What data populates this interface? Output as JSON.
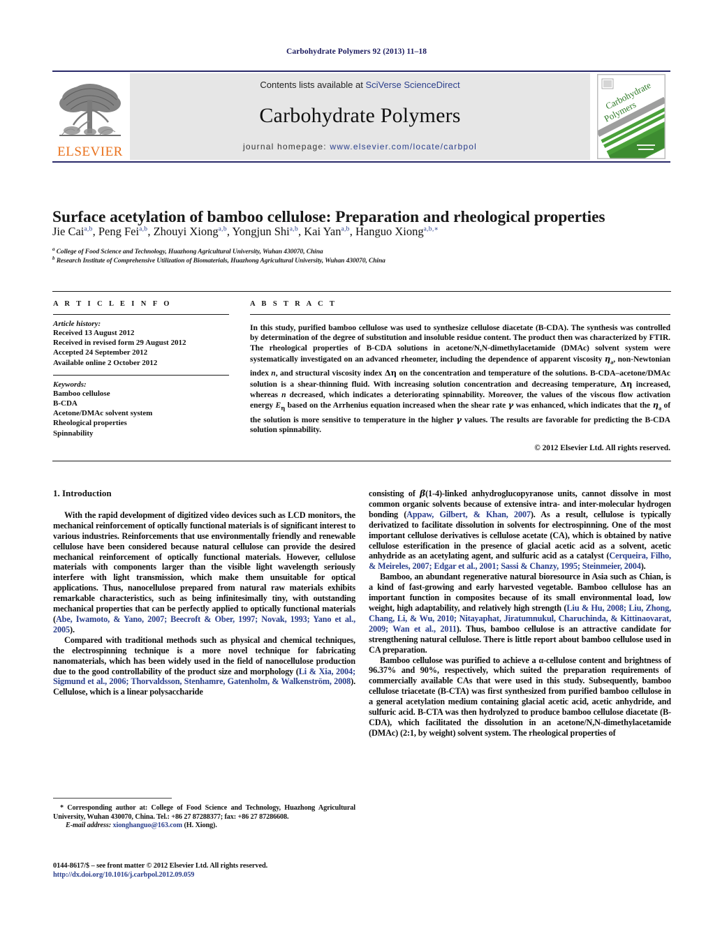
{
  "running_head": "Carbohydrate Polymers 92 (2013) 11–18",
  "masthead": {
    "publisher_logo_label": "ELSEVIER",
    "contents_prefix": "Contents lists available at ",
    "contents_link": "SciVerse ScienceDirect",
    "journal_title": "Carbohydrate Polymers",
    "homepage_prefix": "journal homepage: ",
    "homepage_url": "www.elsevier.com/locate/carbpol",
    "cover_title_line1": "Carbohydrate",
    "cover_title_line2": "Polymers",
    "link_color": "#2b3f8c",
    "logo_color": "#E9711C",
    "band_color": "#e6e6e6"
  },
  "article": {
    "title": "Surface acetylation of bamboo cellulose: Preparation and rheological properties",
    "authors": [
      {
        "name": "Jie Cai",
        "sup": "a,b"
      },
      {
        "name": "Peng Fei",
        "sup": "a,b"
      },
      {
        "name": "Zhouyi Xiong",
        "sup": "a,b"
      },
      {
        "name": "Yongjun Shi",
        "sup": "a,b"
      },
      {
        "name": "Kai Yan",
        "sup": "a,b"
      },
      {
        "name": "Hanguo Xiong",
        "sup": "a,b,∗"
      }
    ],
    "affiliations": [
      {
        "marker": "a",
        "text": "College of Food Science and Technology, Huazhong Agricultural University, Wuhan 430070, China"
      },
      {
        "marker": "b",
        "text": "Research Institute of Comprehensive Utilization of Biomaterials, Huazhong Agricultural University, Wuhan 430070, China"
      }
    ]
  },
  "article_info": {
    "heading": "A R T I C L E     I N F O",
    "history_label": "Article history:",
    "history": [
      "Received 13 August 2012",
      "Received in revised form 29 August 2012",
      "Accepted 24 September 2012",
      "Available online 2 October 2012"
    ],
    "keywords_label": "Keywords:",
    "keywords": [
      "Bamboo cellulose",
      "B-CDA",
      "Acetone/DMAc solvent system",
      "Rheological properties",
      "Spinnability"
    ]
  },
  "abstract": {
    "heading": "A B S T R A C T",
    "copyright": "© 2012 Elsevier Ltd. All rights reserved.",
    "p1_a": "In this study, purified bamboo cellulose was used to synthesize cellulose diacetate (B-CDA). The synthesis was controlled by determination of the degree of substitution and insoluble residue content. The product then was characterized by FTIR. The rheological properties of B-CDA solutions in acetone/N,N-dimethylacetamide (DMAc) solvent system were systematically investigated on an advanced rheometer, including the dependence of apparent viscosity ",
    "eta_a": "η",
    "eta_a_sub": "a",
    "p1_b": ", non-Newtonian index ",
    "n_sym": "n",
    "p1_c": ", and structural viscosity index ",
    "delta_eta": "Δη",
    "p1_d": " on the concentration and temperature of the solutions. B-CDA–acetone/DMAc solution is a shear-thinning fluid. With increasing solution concentration and decreasing temperature, ",
    "delta_eta2": "Δη",
    "p1_e": " increased, whereas ",
    "n_sym2": "n",
    "p1_f": " decreased, which indicates a deteriorating spinnability. Moreover, the values of the viscous flow activation energy ",
    "e_eta": "E",
    "e_eta_sub": "η",
    "p1_g": " based on the Arrhenius equation increased when the shear rate ",
    "gamma": "γ",
    "p1_h": " was enhanced, which indicates that the ",
    "eta_a2": "η",
    "eta_a2_sub": "a",
    "p1_i": " of the solution is more sensitive to temperature in the higher ",
    "gamma2": "γ",
    "p1_j": " values. The results are favorable for predicting the B-CDA solution spinnability."
  },
  "intro": {
    "heading": "1.  Introduction",
    "left": {
      "p1_a": "With the rapid development of digitized video devices such as LCD monitors, the mechanical reinforcement of optically functional materials is of significant interest to various industries. Reinforcements that use environmentally friendly and renewable cellulose have been considered because natural cellulose can provide the desired mechanical reinforcement of optically functional materials. However, cellulose materials with components larger than the visible light wavelength seriously interfere with light transmission, which make them unsuitable for optical applications. Thus, nanocellulose prepared from natural raw materials exhibits remarkable characteristics, such as being infinitesimally tiny, with outstanding mechanical properties that can be perfectly applied to optically functional materials (",
      "p1_cite": "Abe, Iwamoto, & Yano, 2007; Beecroft & Ober, 1997; Novak, 1993; Yano et al., 2005",
      "p1_b": ").",
      "p2_a": "Compared with traditional methods such as physical and chemical techniques, the electrospinning technique is a more novel technique for fabricating nanomaterials, which has been widely used in the field of nanocellulose production due to the good controllability of the product size and morphology (",
      "p2_cite": "Li & Xia, 2004; Sigmund et al., 2006; Thorvaldsson, Stenhamre, Gatenholm, & Walkenström, 2008",
      "p2_b": "). Cellulose, which is a linear polysaccharide"
    },
    "right": {
      "p1_a": "consisting of ",
      "p1_beta": "β",
      "p1_b": "(1-4)-linked anhydroglucopyranose units, cannot dissolve in most common organic solvents because of extensive intra- and inter-molecular hydrogen bonding (",
      "p1_cite": "Appaw, Gilbert, & Khan, 2007",
      "p1_c": "). As a result, cellulose is typically derivatized to facilitate dissolution in solvents for electrospinning. One of the most important cellulose derivatives is cellulose acetate (CA), which is obtained by native cellulose esterification in the presence of glacial acetic acid as a solvent, acetic anhydride as an acetylating agent, and sulfuric acid as a catalyst (",
      "p1_cite2": "Cerqueira, Filho, & Meireles, 2007; Edgar et al., 2001; Sassi & Chanzy, 1995; Steinmeier, 2004",
      "p1_d": ").",
      "p2_a": "Bamboo, an abundant regenerative natural bioresource in Asia such as Chian, is a kind of fast-growing and early harvested vegetable. Bamboo cellulose has an important function in composites because of its small environmental load, low weight, high adaptability, and relatively high strength (",
      "p2_cite": "Liu & Hu, 2008; Liu, Zhong, Chang, Li, & Wu, 2010; Nitayaphat, Jiratumnukul, Charuchinda, & Kittinaovarat, 2009; Wan et al., 2011",
      "p2_b": "). Thus, bamboo cellulose is an attractive candidate for strengthening natural cellulose. There is little report about bamboo cellulose used in CA preparation.",
      "p3": "Bamboo cellulose was purified to achieve a α-cellulose content and brightness of 96.37% and 90%, respectively, which suited the preparation requirements of commercially available CAs that were used in this study. Subsequently, bamboo cellulose triacetate (B-CTA) was first synthesized from purified bamboo cellulose in a general acetylation medium containing glacial acetic acid, acetic anhydride, and sulfuric acid. B-CTA was then hydrolyzed to produce bamboo cellulose diacetate (B-CDA), which facilitated the dissolution in an acetone/N,N-dimethylacetamide (DMAc) (2:1, by weight) solvent system. The rheological properties of"
    }
  },
  "footnotes": {
    "corresponding": "* Corresponding author at: College of Food Science and Technology, Huazhong Agricultural University, Wuhan 430070, China. Tel.: +86 27 87288377; fax: +86 27 87286608.",
    "email_label": "E-mail address:",
    "email": "xionghanguo@163.com",
    "email_suffix": " (H. Xiong)."
  },
  "imprint": {
    "line1": "0144-8617/$ – see front matter © 2012 Elsevier Ltd. All rights reserved.",
    "doi": "http://dx.doi.org/10.1016/j.carbpol.2012.09.059"
  }
}
